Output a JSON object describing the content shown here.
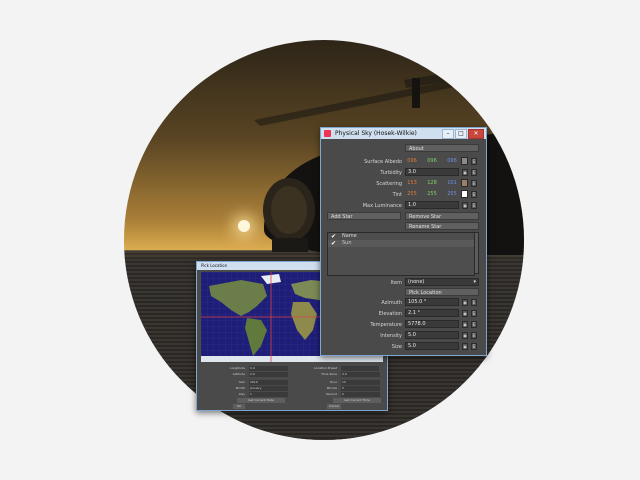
{
  "physical_sky": {
    "title": "Physical Sky (Hosek-Wilkie)",
    "about": "About",
    "surface_albedo": {
      "label": "Surface Albedo",
      "r": "096",
      "g": "096",
      "b": "096"
    },
    "turbidity": {
      "label": "Turbidity",
      "value": "3.0"
    },
    "scattering": {
      "label": "Scattering",
      "r": "153",
      "g": "128",
      "b": "101"
    },
    "tint": {
      "label": "Tint",
      "r": "255",
      "g": "255",
      "b": "255"
    },
    "max_luminance": {
      "label": "Max Luminance",
      "value": "1.0"
    },
    "add_star": "Add Star",
    "remove_star": "Remove Star",
    "rename_star": "Rename Star",
    "list_header": "Name",
    "list_item": "Sun",
    "item": {
      "label": "Item",
      "value": "(none)"
    },
    "pick_location": "Pick Location",
    "azimuth": {
      "label": "Azimuth",
      "value": "105.0 °"
    },
    "elevation": {
      "label": "Elevation",
      "value": "2.1 °"
    },
    "temperature": {
      "label": "Temperature",
      "value": "5778.0"
    },
    "intensity": {
      "label": "Intensity",
      "value": "5.0"
    },
    "size": {
      "label": "Size",
      "value": "5.0"
    },
    "colors": {
      "r": "#e07a3a",
      "g": "#7fd06a",
      "b": "#6f8fe6"
    }
  },
  "pick_location": {
    "title": "Pick Location",
    "left_rows": [
      {
        "label": "Longitude",
        "value": "0.0"
      },
      {
        "label": "Latitude",
        "value": "0.0"
      },
      {
        "label": "",
        "value": ""
      },
      {
        "label": "Year",
        "value": "2019"
      },
      {
        "label": "Month",
        "value": "January"
      },
      {
        "label": "Day",
        "value": "1"
      }
    ],
    "right_rows": [
      {
        "label": "Location Preset",
        "value": ""
      },
      {
        "label": "Time Zone",
        "value": "0.0"
      },
      {
        "label": "",
        "value": ""
      },
      {
        "label": "Hour",
        "value": "12"
      },
      {
        "label": "Minute",
        "value": "0"
      },
      {
        "label": "Second",
        "value": "0"
      }
    ],
    "left_button": "Get Current Date",
    "right_button": "Get Current Time",
    "ok": "OK",
    "cancel": "Cancel"
  }
}
